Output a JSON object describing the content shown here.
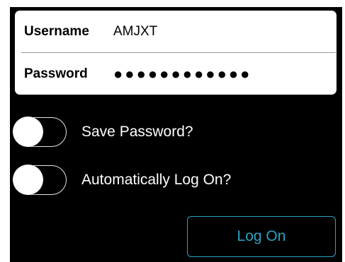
{
  "login_form": {
    "username": {
      "label": "Username",
      "value": "AMJXT"
    },
    "password": {
      "label": "Password",
      "value": "●●●●●●●●●●●●"
    }
  },
  "options": {
    "save_password": {
      "label": "Save Password?",
      "enabled": false
    },
    "auto_log_on": {
      "label": "Automatically Log On?",
      "enabled": false
    }
  },
  "actions": {
    "log_on_label": "Log On"
  },
  "colors": {
    "background": "#000000",
    "card": "#ffffff",
    "accent": "#2aa3c4",
    "divider": "#9a9a9a"
  }
}
